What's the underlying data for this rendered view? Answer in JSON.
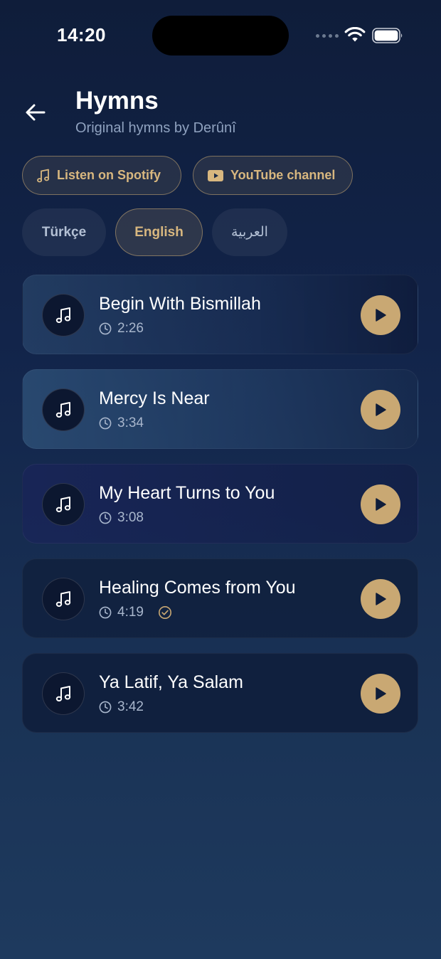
{
  "status_bar": {
    "time": "14:20"
  },
  "header": {
    "title": "Hymns",
    "subtitle": "Original hymns by Derûnî"
  },
  "links": {
    "spotify_label": "Listen on Spotify",
    "youtube_label": "YouTube channel"
  },
  "languages": [
    {
      "label": "Türkçe",
      "selected": false
    },
    {
      "label": "English",
      "selected": true
    },
    {
      "label": "العربية",
      "selected": false
    }
  ],
  "tracks": [
    {
      "title": "Begin With Bismillah",
      "duration": "2:26",
      "completed": false
    },
    {
      "title": "Mercy Is Near",
      "duration": "3:34",
      "completed": false
    },
    {
      "title": "My Heart Turns to You",
      "duration": "3:08",
      "completed": false
    },
    {
      "title": "Healing Comes from You",
      "duration": "4:19",
      "completed": true
    },
    {
      "title": "Ya Latif, Ya Salam",
      "duration": "3:42",
      "completed": false
    }
  ],
  "icons": {
    "back": "arrow-left-icon",
    "spotify": "music-note-icon",
    "youtube": "youtube-icon",
    "track": "music-note-icon",
    "duration": "clock-icon",
    "completed": "check-circle-icon",
    "play": "play-icon"
  },
  "colors": {
    "accent": "#c9a873",
    "background_top": "#0f1d3a",
    "background_bottom": "#1e3a5e",
    "muted_text": "#8fa2bf"
  }
}
